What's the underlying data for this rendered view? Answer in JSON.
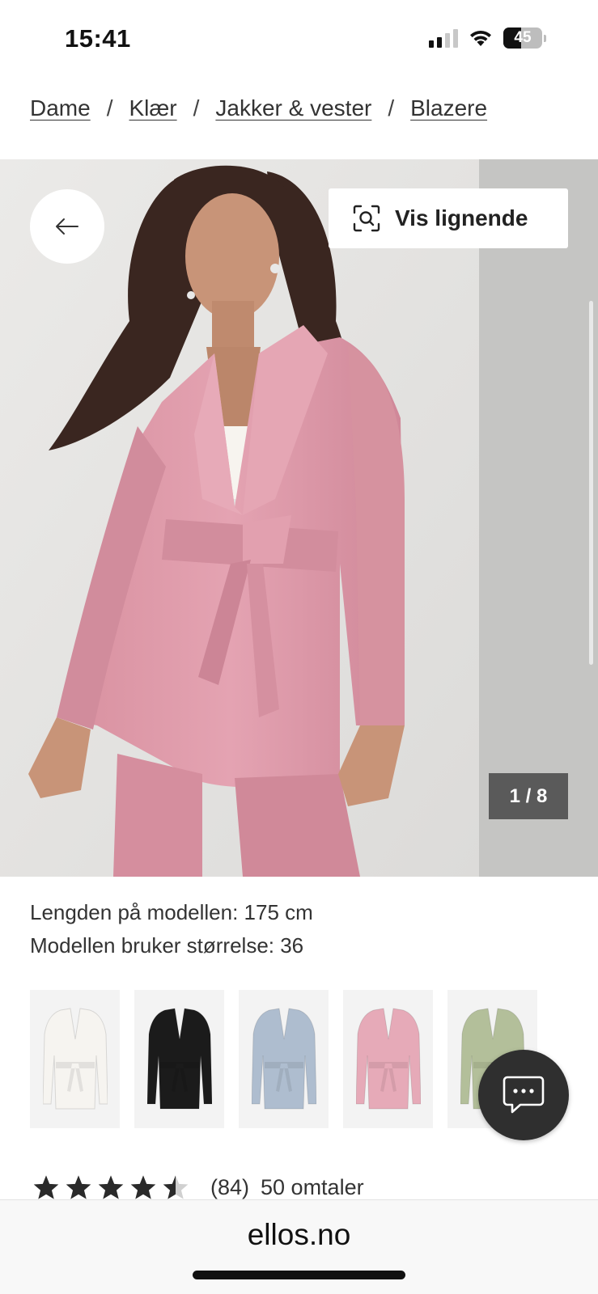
{
  "status": {
    "time": "15:41",
    "battery": "45",
    "battery_level": 0.45,
    "signal_bars": 2
  },
  "breadcrumb": [
    "Dame",
    "Klær",
    "Jakker & vester",
    "Blazere"
  ],
  "product": {
    "similar_label": "Vis lignende",
    "image_counter": "1 / 8",
    "model_height": "Lengden på modellen: 175 cm",
    "model_size": "Modellen bruker størrelse: 36",
    "colors": [
      {
        "name": "white",
        "hex": "#f6f4f0"
      },
      {
        "name": "black",
        "hex": "#1b1b1b"
      },
      {
        "name": "light blue",
        "hex": "#aebdcf"
      },
      {
        "name": "pink",
        "hex": "#e6aab8"
      },
      {
        "name": "sage green",
        "hex": "#b3bf9a"
      }
    ],
    "jacket_color": "#dc9aa9",
    "rating": {
      "value": 4.5,
      "max": 5,
      "count": "(84)",
      "reviews": "50 omtaler"
    }
  },
  "browser": {
    "url": "ellos.no"
  }
}
